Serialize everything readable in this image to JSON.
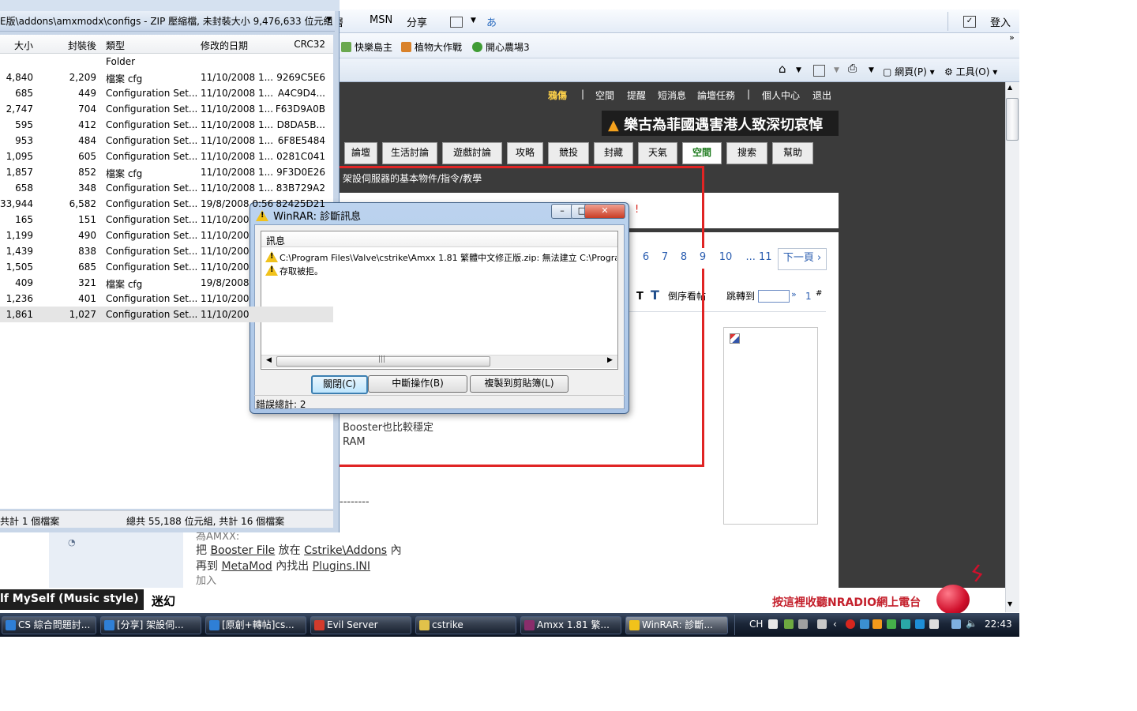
{
  "ie_toolbar": {
    "partial_label": "層",
    "msn": "MSN",
    "share": "分享",
    "login": "登入",
    "home_icon": "home-icon",
    "feeds_icon": "rss-icon",
    "print_icon": "printer-icon",
    "page_menu": "網頁(P)",
    "tools_menu": "工具(O)"
  },
  "favorites": [
    {
      "label": "快樂島主",
      "color": "#6aa84f"
    },
    {
      "label": "植物大作戰",
      "color": "#d9822b"
    },
    {
      "label": "開心農場3",
      "color": "#3f9c35"
    }
  ],
  "site": {
    "toplinks": [
      "鴉傷",
      "|",
      "空間",
      "提醒",
      "短消息",
      "論壇任務",
      "|",
      "個人中心",
      "退出"
    ],
    "banner": "樂古為菲國遇害港人致深切哀悼",
    "navtabs": [
      "論壇",
      "生活討論",
      "遊戲討論",
      "攻略",
      "競投",
      "封藏",
      "天氣",
      "空間",
      "搜索",
      "幫助"
    ],
    "active_tab": "空間",
    "breadcrumb": "架設伺服器的基本物件/指令/教學",
    "red_notice": "!",
    "pages": [
      "6",
      "7",
      "8",
      "9",
      "10",
      "... 11"
    ],
    "next_page": "下一頁",
    "reverse_view": "倒序看帖",
    "jump_to": "跳轉到",
    "jump_suffix": "»",
    "floor": "1",
    "floor_hash": "#",
    "post_line1": "Booster也比較穩定",
    "post_line2": "RAM",
    "dashes": "--------",
    "post_amxx": "為AMXX:",
    "post_put_pre": "把",
    "post_put_file": "Booster File",
    "post_put_mid": "放在",
    "post_put_dir": "Cstrike\\Addons",
    "post_put_post": "內",
    "post_again_pre": "再到",
    "post_again_mm": "MetaMod",
    "post_again_mid": "內找出",
    "post_again_ini": "Plugins.INI",
    "post_add": "加入",
    "music_title": "lf MySelf (Music style)",
    "music_song": "迷幻",
    "radio_promo": "按這裡收聽NRADIO網上電台"
  },
  "rar": {
    "title": "E版\\addons\\amxmodx\\configs - ZIP 壓縮檔, 未封裝大小 9,476,633 位元組",
    "columns": [
      "大小",
      "封裝後",
      "類型",
      "修改的日期",
      "CRC32"
    ],
    "rows": [
      {
        "size": "",
        "packed": "",
        "type": "Folder",
        "date": "",
        "crc": ""
      },
      {
        "size": "4,840",
        "packed": "2,209",
        "type": "檔案 cfg",
        "date": "11/10/2008 1...",
        "crc": "9269C5E6"
      },
      {
        "size": "685",
        "packed": "449",
        "type": "Configuration Set...",
        "date": "11/10/2008 1...",
        "crc": "A4C9D4..."
      },
      {
        "size": "2,747",
        "packed": "704",
        "type": "Configuration Set...",
        "date": "11/10/2008 1...",
        "crc": "F63D9A0B"
      },
      {
        "size": "595",
        "packed": "412",
        "type": "Configuration Set...",
        "date": "11/10/2008 1...",
        "crc": "D8DA5B..."
      },
      {
        "size": "953",
        "packed": "484",
        "type": "Configuration Set...",
        "date": "11/10/2008 1...",
        "crc": "6F8E5484"
      },
      {
        "size": "1,095",
        "packed": "605",
        "type": "Configuration Set...",
        "date": "11/10/2008 1...",
        "crc": "0281C041"
      },
      {
        "size": "1,857",
        "packed": "852",
        "type": "檔案 cfg",
        "date": "11/10/2008 1...",
        "crc": "9F3D0E26"
      },
      {
        "size": "658",
        "packed": "348",
        "type": "Configuration Set...",
        "date": "11/10/2008 1...",
        "crc": "83B729A2"
      },
      {
        "size": "33,944",
        "packed": "6,582",
        "type": "Configuration Set...",
        "date": "19/8/2008 0:56",
        "crc": "82425D21"
      },
      {
        "size": "165",
        "packed": "151",
        "type": "Configuration Set...",
        "date": "11/10/200",
        "crc": ""
      },
      {
        "size": "1,199",
        "packed": "490",
        "type": "Configuration Set...",
        "date": "11/10/200",
        "crc": ""
      },
      {
        "size": "1,439",
        "packed": "838",
        "type": "Configuration Set...",
        "date": "11/10/200",
        "crc": ""
      },
      {
        "size": "1,505",
        "packed": "685",
        "type": "Configuration Set...",
        "date": "11/10/200",
        "crc": ""
      },
      {
        "size": "409",
        "packed": "321",
        "type": "檔案 cfg",
        "date": "19/8/2008",
        "crc": ""
      },
      {
        "size": "1,236",
        "packed": "401",
        "type": "Configuration Set...",
        "date": "11/10/200",
        "crc": ""
      },
      {
        "size": "1,861",
        "packed": "1,027",
        "type": "Configuration Set...",
        "date": "11/10/200",
        "crc": ""
      }
    ],
    "status_left": "共計 1 個檔案",
    "status_right": "總共 55,188 位元組, 共計 16 個檔案"
  },
  "dialog": {
    "title": "WinRAR: 診斷訊息",
    "column": "訊息",
    "messages": [
      "C:\\Program Files\\Valve\\cstrike\\Amxx 1.81 繁體中文修正版.zip: 無法建立 C:\\Program Fil",
      "存取被拒。"
    ],
    "btn_close": "關閉(C)",
    "btn_abort": "中斷操作(B)",
    "btn_copy": "複製到剪貼簿(L)",
    "status": "錯誤總計: 2"
  },
  "taskbar": {
    "tasks": [
      {
        "label": "CS 綜合問題討...",
        "color": "#2f7fd6"
      },
      {
        "label": "[分享] 架設伺...",
        "color": "#2f7fd6"
      },
      {
        "label": "[原創+轉帖]cs...",
        "color": "#2f7fd6"
      },
      {
        "label": "Evil Server",
        "color": "#d33b2c"
      },
      {
        "label": "cstrike",
        "color": "#e2c24a"
      },
      {
        "label": "Amxx 1.81 繁...",
        "color": "#8a2d6b"
      },
      {
        "label": "WinRAR: 診斷...",
        "color": "#f1c21b"
      }
    ],
    "lang": "CH",
    "clock": "22:43"
  }
}
